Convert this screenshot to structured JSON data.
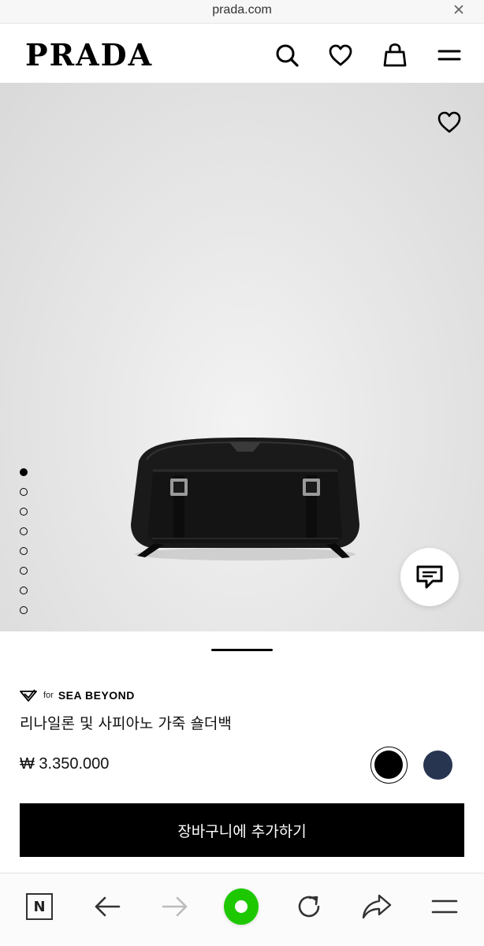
{
  "browser": {
    "url": "prada.com",
    "close_icon": "close-icon"
  },
  "header": {
    "logo": "PRADA",
    "icons": [
      "search-icon",
      "heart-icon",
      "shopping-bag-icon",
      "menu-icon"
    ]
  },
  "gallery": {
    "image_count": 8,
    "active_index": 0,
    "wishlist_icon": "heart-icon",
    "chat_icon": "chat-icon"
  },
  "product": {
    "initiative_for": "for",
    "initiative_name": "SEA BEYOND",
    "title": "리나일론 및 사피아노 가죽 숄더백",
    "price": "₩ 3.350.000",
    "colors": [
      {
        "name": "black",
        "hex": "#000000",
        "selected": true
      },
      {
        "name": "navy",
        "hex": "#283551",
        "selected": false
      }
    ],
    "add_to_cart": "장바구니에 추가하기"
  },
  "browser_toolbar": {
    "naver_label": "N",
    "icons": [
      "naver-home-icon",
      "back-arrow-icon",
      "forward-arrow-icon",
      "green-dot-icon",
      "reload-icon",
      "share-icon",
      "menu-icon"
    ]
  }
}
